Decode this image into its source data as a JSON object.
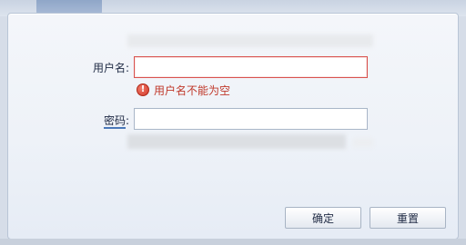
{
  "form": {
    "username_label": "用户名:",
    "username_value": "",
    "username_error": "用户名不能为空",
    "password_label_main": "密码",
    "password_label_colon": ":",
    "password_value": ""
  },
  "buttons": {
    "ok_label": "确定",
    "reset_label": "重置"
  },
  "colors": {
    "error": "#c0392b",
    "error_border": "#d9534f"
  },
  "icons": {
    "error_icon": "exclamation-circle-icon",
    "error_glyph": "!"
  }
}
